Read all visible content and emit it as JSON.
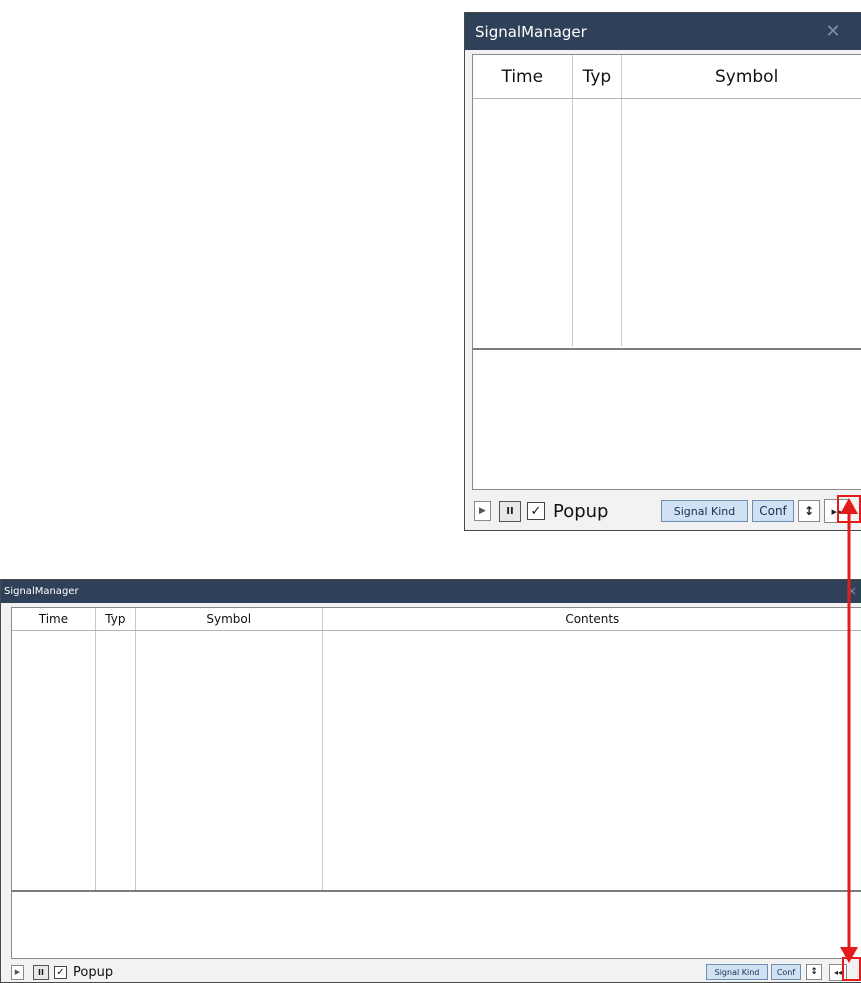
{
  "colors": {
    "titlebar": "#2e4158",
    "button_blue": "#cfe1f3",
    "highlight_red": "#e41b1b"
  },
  "small_window": {
    "title": "SignalManager",
    "close_icon": "close-icon",
    "columns": [
      "Time",
      "Typ",
      "Symbol"
    ],
    "status": {
      "play_icon": "play-icon",
      "pause_icon": "pause-icon",
      "popup_checked": true,
      "popup_label": "Popup",
      "signal_kind_label": "Signal Kind",
      "conf_label": "Conf",
      "sort_icon": "up-down-arrows-icon",
      "expand_icon": "expand-right-icon"
    }
  },
  "large_window": {
    "title": "SignalManager",
    "close_icon": "close-icon",
    "columns": [
      "Time",
      "Typ",
      "Symbol",
      "Contents"
    ],
    "status": {
      "play_icon": "play-icon",
      "pause_icon": "pause-icon",
      "popup_checked": true,
      "popup_label": "Popup",
      "signal_kind_label": "Signal Kind",
      "conf_label": "Conf",
      "sort_icon": "up-down-arrows-icon",
      "collapse_icon": "collapse-left-icon"
    }
  },
  "annotation": {
    "connector": "double-headed-arrow"
  }
}
